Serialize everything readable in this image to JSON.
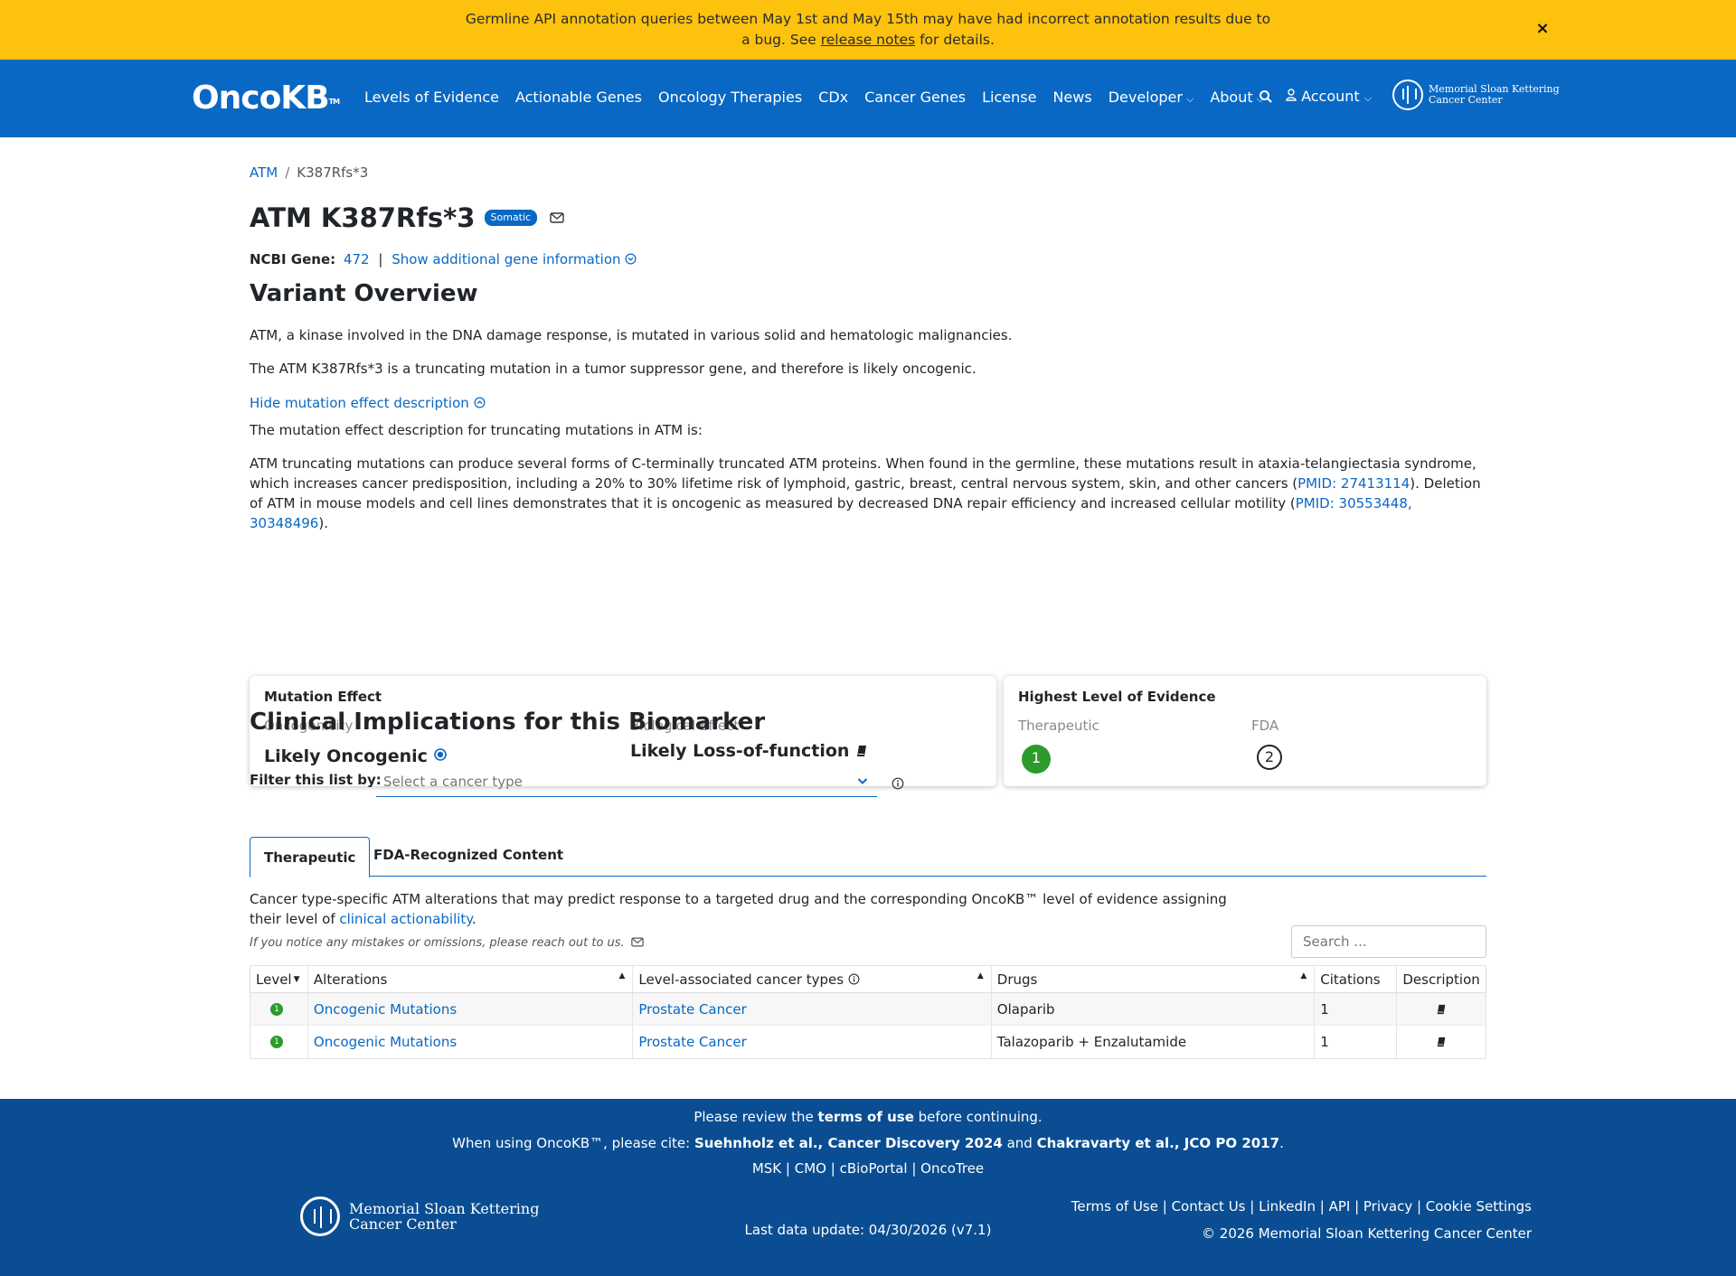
{
  "banner": {
    "text_before": "Germline API annotation queries between May 1st and May 15th may have had incorrect annotation results due to a bug. See ",
    "link": "release notes",
    "text_after": " for details.",
    "close": "×"
  },
  "navbar": {
    "logo": "OncoKB",
    "logo_tm": "TM",
    "items": [
      "Levels of Evidence",
      "Actionable Genes",
      "Oncology Therapies",
      "CDx",
      "Cancer Genes",
      "License",
      "News",
      "Developer",
      "About"
    ],
    "account": "Account",
    "msk_line1": "Memorial Sloan Kettering",
    "msk_line2": "Cancer Center"
  },
  "breadcrumb": {
    "gene": "ATM",
    "sep": "/",
    "variant": "K387Rfs*3"
  },
  "header": {
    "title": "ATM K387Rfs*3",
    "badge": "Somatic"
  },
  "ncbi": {
    "label": "NCBI Gene:",
    "id": "472",
    "sep": "|",
    "more": "Show additional gene information"
  },
  "overview": {
    "heading": "Variant Overview",
    "p1": "ATM, a kinase involved in the DNA damage response, is mutated in various solid and hematologic malignancies.",
    "p2": "The ATM K387Rfs*3 is a truncating mutation in a tumor suppressor gene, and therefore is likely oncogenic.",
    "toggle": "Hide mutation effect description",
    "p3": "The mutation effect description for truncating mutations in ATM is:",
    "p4_a": "ATM truncating mutations can produce several forms of C-terminally truncated ATM proteins. When found in the germline, these mutations result in ataxia-telangiectasia syndrome, which increases cancer predisposition, including a 20% to 30% lifetime risk of lymphoid, gastric, breast, central nervous system, skin, and other cancers (",
    "p4_link1": "PMID: 27413114",
    "p4_b": "). Deletion of ATM in mouse models and cell lines demonstrates that it is oncogenic as measured by decreased DNA repair efficiency and increased cellular motility (",
    "p4_link2": "PMID: 30553448, 30348496",
    "p4_c": ")."
  },
  "mutation_effect": {
    "title": "Mutation Effect",
    "oncogenicity_label": "Oncogenicity",
    "oncogenicity": "Likely Oncogenic",
    "bio_label": "Biological Effect",
    "bio": "Likely Loss-of-function"
  },
  "highest_level": {
    "title": "Highest Level of Evidence",
    "therapeutic_label": "Therapeutic",
    "therapeutic": "1",
    "fda_label": "FDA",
    "fda": "2"
  },
  "clinical": {
    "heading": "Clinical Implications for this Biomarker",
    "filter_label": "Filter this list by:",
    "filter_placeholder": "Select a cancer type",
    "tabs": [
      "Therapeutic",
      "FDA-Recognized Content"
    ],
    "desc_a": "Cancer type-specific ATM alterations that may predict response to a targeted drug and the corresponding OncoKB™ level of evidence assigning their level of ",
    "desc_link": "clinical actionability",
    "desc_b": ".",
    "note": "If you notice any mistakes or omissions, please reach out to us.",
    "search_placeholder": "Search ...",
    "columns": [
      "Level",
      "Alterations",
      "Level-associated cancer types",
      "Drugs",
      "Citations",
      "Description"
    ],
    "rows": [
      {
        "level": "1",
        "alteration": "Oncogenic Mutations",
        "cancer": "Prostate Cancer",
        "drugs": "Olaparib",
        "citations": "1"
      },
      {
        "level": "1",
        "alteration": "Oncogenic Mutations",
        "cancer": "Prostate Cancer",
        "drugs": "Talazoparib + Enzalutamide",
        "citations": "1"
      }
    ]
  },
  "footer": {
    "review_a": "Please review the ",
    "review_link": "terms of use",
    "review_b": " before continuing.",
    "cite_a": "When using OncoKB™, please cite: ",
    "cite_1": "Suehnholz et al., Cancer Discovery 2024",
    "cite_and": " and ",
    "cite_2": "Chakravarty et al., JCO PO 2017",
    "cite_b": ".",
    "links": [
      "MSK",
      "CMO",
      "cBioPortal",
      "OncoTree"
    ],
    "msk_line1": "Memorial Sloan Kettering",
    "msk_line2": "Cancer Center",
    "last_update": "Last data update: 04/30/2026 (v7.1)",
    "right_links": [
      "Terms of Use",
      "Contact Us",
      "LinkedIn",
      "API",
      "Privacy",
      "Cookie Settings"
    ],
    "copyright": "© 2026 Memorial Sloan Kettering Cancer Center"
  },
  "colors": {
    "brand": "#0968c3",
    "banner": "#fcc20e",
    "footer": "#0a4d92",
    "level1": "#2c9b2c"
  }
}
